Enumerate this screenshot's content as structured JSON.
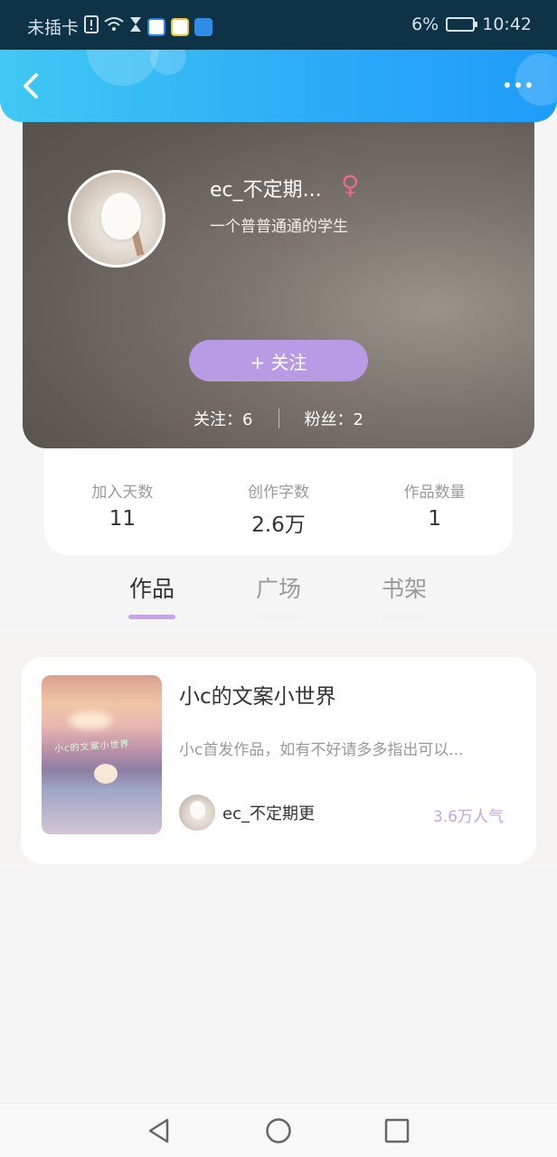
{
  "status_bar": {
    "carrier": "未插卡",
    "battery": "6%",
    "time": "10:42",
    "icons": [
      "sim-alert-icon",
      "wifi-icon",
      "hourglass-icon",
      "baidu-app-icon",
      "chat-app-icon",
      "weather-app-icon",
      "battery-icon"
    ]
  },
  "header": {
    "back_icon": "chevron-left-icon",
    "more_icon": "more-dots-icon",
    "accent": "#2aaaf7"
  },
  "profile": {
    "username": "ec_不定期...",
    "gender_symbol": "♀",
    "bio": "一个普普通通的学生",
    "follow_button": "+ 关注",
    "following": "关注：6",
    "fans": "粉丝：2"
  },
  "stats": [
    {
      "label": "加入天数",
      "value": "11"
    },
    {
      "label": "创作字数",
      "value": "2.6万"
    },
    {
      "label": "作品数量",
      "value": "1"
    }
  ],
  "tabs": [
    {
      "label": "作品",
      "active": true
    },
    {
      "label": "广场",
      "active": false
    },
    {
      "label": "书架",
      "active": false
    }
  ],
  "work": {
    "cover_text": "小c的文案小世界",
    "title": "小c的文案小世界",
    "description": "小c首发作品，如有不好请多多指出可以...",
    "author": "ec_不定期更",
    "popularity": "3.6万人气",
    "popularity_color": "#c4a4ea"
  },
  "nav": {
    "back": "triangle-back-icon",
    "home": "circle-home-icon",
    "recent": "square-recent-icon"
  }
}
